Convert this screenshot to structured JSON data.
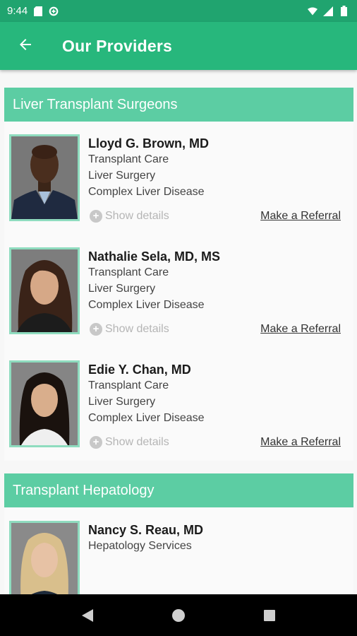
{
  "status_bar": {
    "time": "9:44",
    "icons": [
      "sd-card-icon",
      "data-saver-icon",
      "wifi-icon",
      "signal-icon",
      "battery-icon"
    ]
  },
  "app_bar": {
    "title": "Our Providers",
    "back_icon": "arrow-left-icon"
  },
  "colors": {
    "status_bar": "#20a46f",
    "app_bar": "#27b77c",
    "section_header": "#5ccda3",
    "photo_border": "#8fdcbf"
  },
  "sections": [
    {
      "title": "Liver Transplant Surgeons",
      "providers": [
        {
          "name": "Lloyd G. Brown, MD",
          "specialties": [
            "Transplant Care",
            "Liver Surgery",
            "Complex Liver Disease"
          ],
          "details_label": "Show details",
          "referral_label": "Make a Referral"
        },
        {
          "name": "Nathalie  Sela, MD, MS",
          "specialties": [
            "Transplant Care",
            "Liver Surgery",
            "Complex Liver Disease"
          ],
          "details_label": "Show details",
          "referral_label": "Make a Referral"
        },
        {
          "name": "Edie Y. Chan, MD",
          "specialties": [
            "Transplant Care",
            "Liver Surgery",
            "Complex Liver Disease"
          ],
          "details_label": "Show details",
          "referral_label": "Make a Referral"
        }
      ]
    },
    {
      "title": "Transplant Hepatology",
      "providers": [
        {
          "name": "Nancy S. Reau, MD",
          "specialties": [
            "Hepatology Services"
          ]
        }
      ]
    }
  ],
  "nav_bar": {
    "icons": [
      "back-triangle-icon",
      "home-circle-icon",
      "recents-square-icon"
    ]
  }
}
